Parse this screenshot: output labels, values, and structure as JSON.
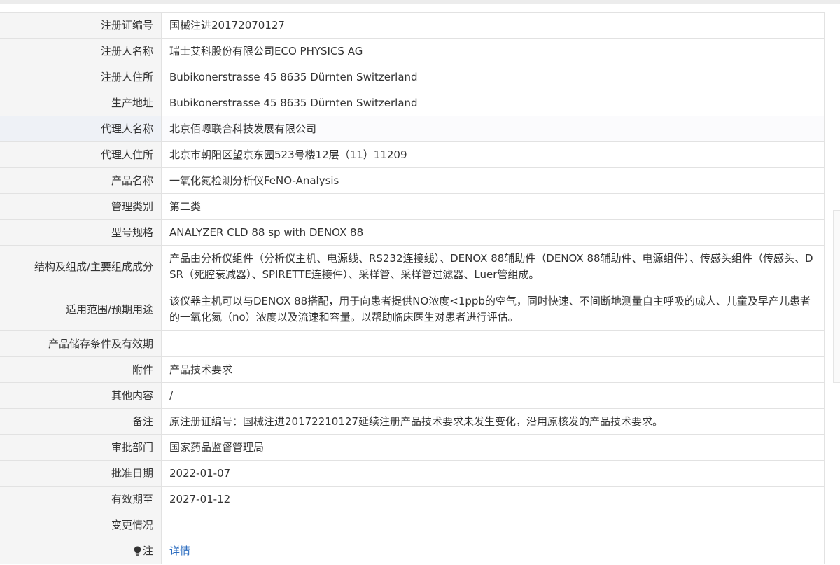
{
  "rows": [
    {
      "label": "注册证编号",
      "value": "国械注进20172070127"
    },
    {
      "label": "注册人名称",
      "value": "瑞士艾科股份有限公司ECO PHYSICS AG"
    },
    {
      "label": "注册人住所",
      "value": "Bubikonerstrasse 45 8635 Dürnten Switzerland"
    },
    {
      "label": "生产地址",
      "value": "Bubikonerstrasse 45 8635 Dürnten Switzerland"
    },
    {
      "label": "代理人名称",
      "value": "北京佰嗯联合科技发展有限公司"
    },
    {
      "label": "代理人住所",
      "value": "北京市朝阳区望京东园523号楼12层（11）11209"
    },
    {
      "label": "产品名称",
      "value": "一氧化氮检测分析仪FeNO-Analysis"
    },
    {
      "label": "管理类别",
      "value": "第二类"
    },
    {
      "label": "型号规格",
      "value": "ANALYZER CLD 88 sp with DENOX 88"
    },
    {
      "label": "结构及组成/主要组成成分",
      "value": "产品由分析仪组件（分析仪主机、电源线、RS232连接线）、DENOX 88辅助件（DENOX 88辅助件、电源组件）、传感头组件（传感头、DSR（死腔衰减器）、SPIRETTE连接件）、采样管、采样管过滤器、Luer管组成。"
    },
    {
      "label": "适用范围/预期用途",
      "value": "该仪器主机可以与DENOX 88搭配，用于向患者提供NO浓度<1ppb的空气，同时快速、不间断地测量自主呼吸的成人、儿童及早产儿患者的一氧化氮（no）浓度以及流速和容量。以帮助临床医生对患者进行评估。"
    },
    {
      "label": "产品储存条件及有效期",
      "value": ""
    },
    {
      "label": "附件",
      "value": "产品技术要求"
    },
    {
      "label": "其他内容",
      "value": "/"
    },
    {
      "label": "备注",
      "value": "原注册证编号：国械注进20172210127延续注册产品技术要求未发生变化，沿用原核发的产品技术要求。"
    },
    {
      "label": "审批部门",
      "value": "国家药品监督管理局"
    },
    {
      "label": "批准日期",
      "value": "2022-01-07"
    },
    {
      "label": "有效期至",
      "value": "2027-01-12"
    },
    {
      "label": "变更情况",
      "value": ""
    }
  ],
  "note_row": {
    "label": "注",
    "icon": "lightbulb-icon",
    "link_text": "详情"
  }
}
